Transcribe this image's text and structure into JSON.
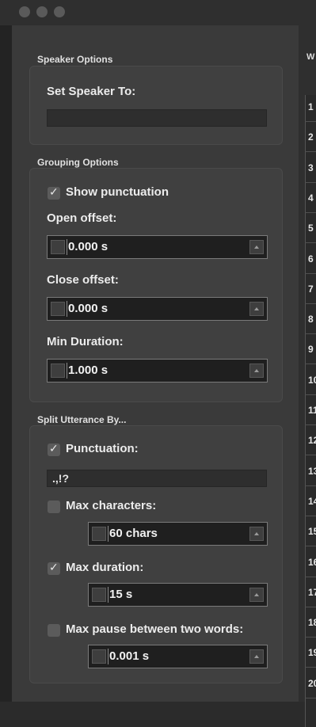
{
  "speaker_options": {
    "title": "Speaker Options",
    "set_speaker_label": "Set Speaker To:",
    "speaker_value": ""
  },
  "grouping_options": {
    "title": "Grouping Options",
    "show_punctuation": {
      "label": "Show punctuation",
      "checked": true
    },
    "open_offset": {
      "label": "Open offset:",
      "value": "0.000 s"
    },
    "close_offset": {
      "label": "Close offset:",
      "value": "0.000 s"
    },
    "min_duration": {
      "label": "Min Duration:",
      "value": "1.000 s"
    }
  },
  "split_utterance": {
    "title": "Split Utterance By...",
    "punctuation": {
      "label": "Punctuation:",
      "checked": true,
      "value": ".,!?"
    },
    "max_characters": {
      "label": "Max characters:",
      "checked": false,
      "value": "60 chars"
    },
    "max_duration": {
      "label": "Max duration:",
      "checked": true,
      "value": "15 s"
    },
    "max_pause": {
      "label": "Max pause between two words:",
      "checked": false,
      "value": "0.001 s"
    }
  },
  "right_table": {
    "header": "W",
    "row_numbers": [
      "1",
      "2",
      "3",
      "4",
      "5",
      "6",
      "7",
      "8",
      "9",
      "10",
      "11",
      "12",
      "13",
      "14",
      "15",
      "16",
      "17",
      "18",
      "19",
      "20"
    ]
  }
}
